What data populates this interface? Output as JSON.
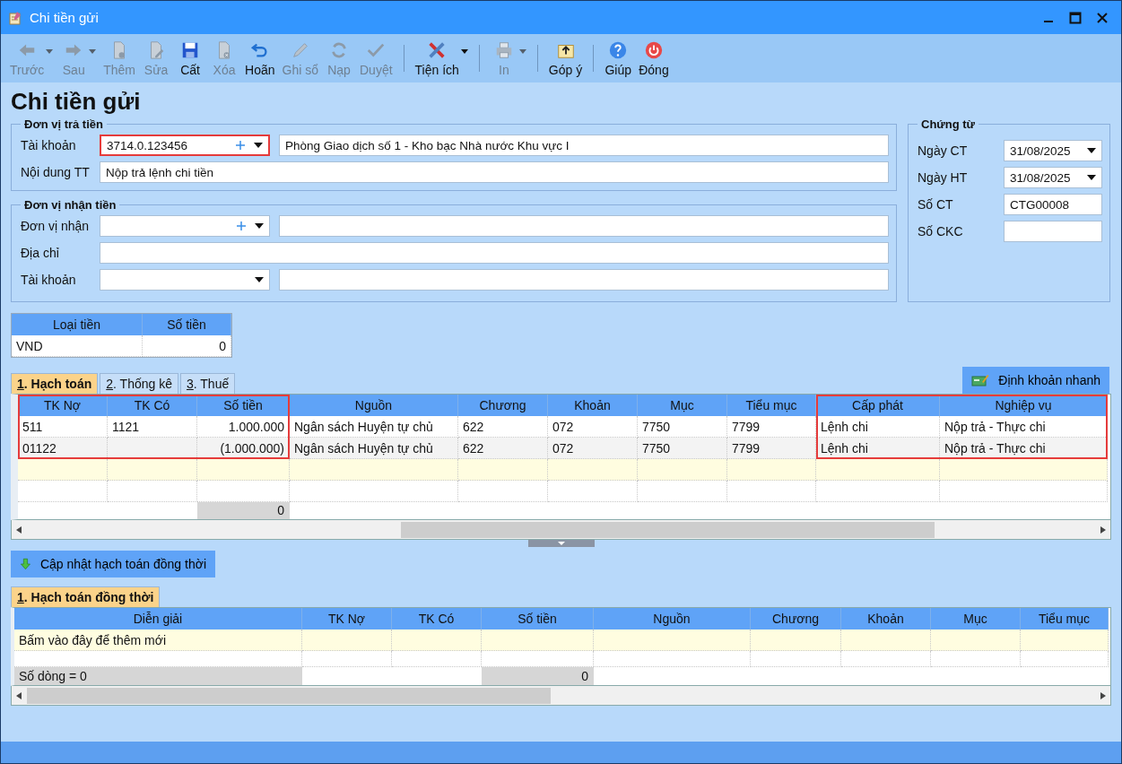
{
  "window": {
    "title": "Chi tiền gửi"
  },
  "toolbar": [
    {
      "kind": "back",
      "label": "Trước",
      "enabled": false,
      "dropdown": true
    },
    {
      "kind": "forward",
      "label": "Sau",
      "enabled": false,
      "dropdown": true
    },
    {
      "kind": "new",
      "label": "Thêm",
      "enabled": false,
      "dropdown": false
    },
    {
      "kind": "edit",
      "label": "Sửa",
      "enabled": false,
      "dropdown": false
    },
    {
      "kind": "save",
      "label": "Cất",
      "enabled": true,
      "dropdown": false
    },
    {
      "kind": "delete",
      "label": "Xóa",
      "enabled": false,
      "dropdown": false
    },
    {
      "kind": "undo",
      "label": "Hoãn",
      "enabled": true,
      "dropdown": false
    },
    {
      "kind": "post",
      "label": "Ghi sổ",
      "enabled": false,
      "dropdown": false
    },
    {
      "kind": "reload",
      "label": "Nạp",
      "enabled": false,
      "dropdown": false
    },
    {
      "kind": "approve",
      "label": "Duyệt",
      "enabled": false,
      "dropdown": false
    },
    {
      "kind": "separator"
    },
    {
      "kind": "tools",
      "label": "Tiện ích",
      "enabled": true,
      "dropdown": true
    },
    {
      "kind": "separator"
    },
    {
      "kind": "print",
      "label": "In",
      "enabled": false,
      "dropdown": true
    },
    {
      "kind": "separator"
    },
    {
      "kind": "feedback",
      "label": "Góp ý",
      "enabled": true,
      "dropdown": false
    },
    {
      "kind": "separator"
    },
    {
      "kind": "help",
      "label": "Giúp",
      "enabled": true,
      "dropdown": false
    },
    {
      "kind": "close",
      "label": "Đóng",
      "enabled": true,
      "dropdown": false
    }
  ],
  "page_title": "Chi tiền gửi",
  "payer": {
    "legend": "Đơn vị trả tiền",
    "account": {
      "label": "Tài khoản",
      "value": "3714.0.123456",
      "add": true,
      "dropdown": true,
      "highlighted": true,
      "name": "Phòng Giao dịch số 1 - Kho bạc Nhà nước Khu vực I"
    },
    "content": {
      "label": "Nội dung TT",
      "value": "Nộp trả lệnh chi tiền"
    }
  },
  "payee": {
    "legend": "Đơn vị nhận tiền",
    "unit": {
      "label": "Đơn vị nhận",
      "add": true,
      "dropdown": true
    },
    "address": {
      "label": "Địa chỉ"
    },
    "account": {
      "label": "Tài khoản",
      "add": false,
      "dropdown": true
    }
  },
  "voucher": {
    "legend": "Chứng từ",
    "fields": [
      {
        "label": "Ngày CT",
        "value": "31/08/2025",
        "kind": "date"
      },
      {
        "label": "Ngày HT",
        "value": "31/08/2025",
        "kind": "date"
      },
      {
        "label": "Số CT",
        "value": "CTG00008",
        "kind": "text"
      },
      {
        "label": "Số CKC",
        "kind": "text"
      }
    ]
  },
  "currency_table": {
    "columns": [
      "Loại tiền",
      "Số tiền"
    ],
    "rows": [
      [
        "VND",
        "0"
      ]
    ]
  },
  "tabs": [
    {
      "hotkey": "1",
      "label": ". Hạch toán",
      "selected": true
    },
    {
      "hotkey": "2",
      "label": ". Thống kê",
      "selected": false
    },
    {
      "hotkey": "3",
      "label": ". Thuế",
      "selected": false
    }
  ],
  "quick_button": "Định khoản nhanh",
  "entries": {
    "columns": [
      {
        "title": "TK Nợ",
        "kind": "text",
        "highlighted": true
      },
      {
        "title": "TK Có",
        "kind": "text",
        "highlighted": true
      },
      {
        "title": "Số tiền",
        "kind": "amount",
        "highlighted": true
      },
      {
        "title": "Nguồn",
        "kind": "text",
        "highlighted": false
      },
      {
        "title": "Chương",
        "kind": "text",
        "highlighted": false
      },
      {
        "title": "Khoản",
        "kind": "text",
        "highlighted": false
      },
      {
        "title": "Mục",
        "kind": "text",
        "highlighted": false
      },
      {
        "title": "Tiểu mục",
        "kind": "text",
        "highlighted": false
      },
      {
        "title": "Cấp phát",
        "kind": "text",
        "highlighted": true
      },
      {
        "title": "Nghiệp vụ",
        "kind": "text",
        "highlighted": true
      }
    ],
    "rows": [
      [
        "511",
        "1121",
        "1.000.000",
        "Ngân sách Huyện tự chủ",
        "622",
        "072",
        "7750",
        "7799",
        "Lệnh chi",
        "Nộp trả - Thực chi"
      ],
      [
        "01122",
        "",
        "(1.000.000)",
        "Ngân sách Huyện tự chủ",
        "622",
        "072",
        "7750",
        "7799",
        "Lệnh chi",
        "Nộp trả - Thực chi"
      ]
    ],
    "total": "0"
  },
  "update_button": "Cập nhật hạch toán đồng thời",
  "concurrent": {
    "tabs": [
      {
        "hotkey": "1",
        "label": ". Hạch toán đồng thời",
        "selected": true
      }
    ],
    "columns": [
      {
        "title": "Diễn giải",
        "kind": "description"
      },
      {
        "title": "TK Nợ",
        "kind": "text"
      },
      {
        "title": "TK Có",
        "kind": "text"
      },
      {
        "title": "Số tiền",
        "kind": "amount"
      },
      {
        "title": "Nguồn",
        "kind": "text"
      },
      {
        "title": "Chương",
        "kind": "text"
      },
      {
        "title": "Khoản",
        "kind": "text"
      },
      {
        "title": "Mục",
        "kind": "text"
      },
      {
        "title": "Tiểu mục",
        "kind": "text"
      }
    ],
    "new_row": "Bấm vào đây để thêm mới",
    "row_count": "Số dòng = 0",
    "total": "0"
  }
}
